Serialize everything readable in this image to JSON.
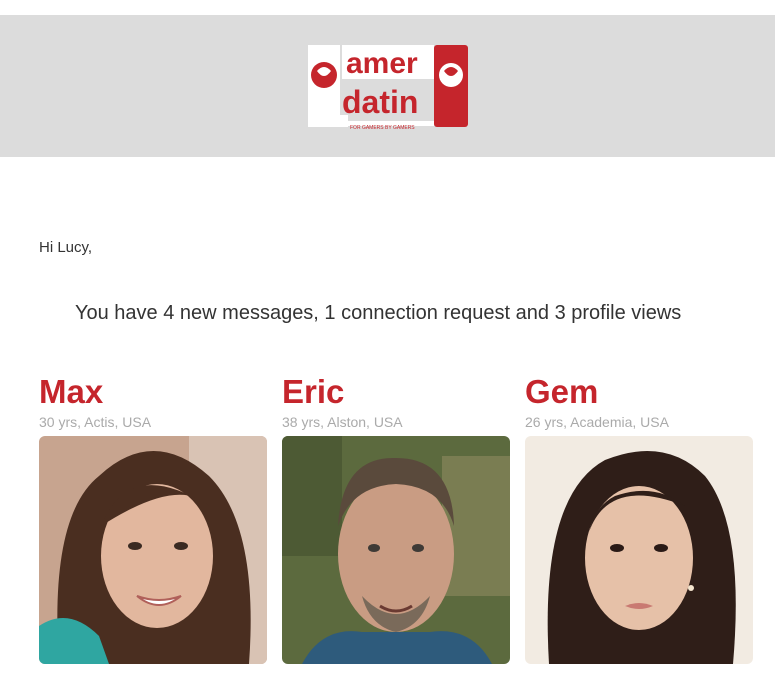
{
  "brand": {
    "logo_alt": "gamer dating",
    "tagline": "For gamers by gamers",
    "accent": "#c5252c",
    "header_bg": "#dcdcdc"
  },
  "email": {
    "greeting": "Hi Lucy,",
    "summary": "You have 4 new messages, 1 connection request and 3 profile views"
  },
  "profiles": [
    {
      "name": "Max",
      "meta": "30 yrs, Actis, USA"
    },
    {
      "name": "Eric",
      "meta": "38 yrs, Alston, USA"
    },
    {
      "name": "Gem",
      "meta": "26 yrs, Academia, USA"
    }
  ]
}
